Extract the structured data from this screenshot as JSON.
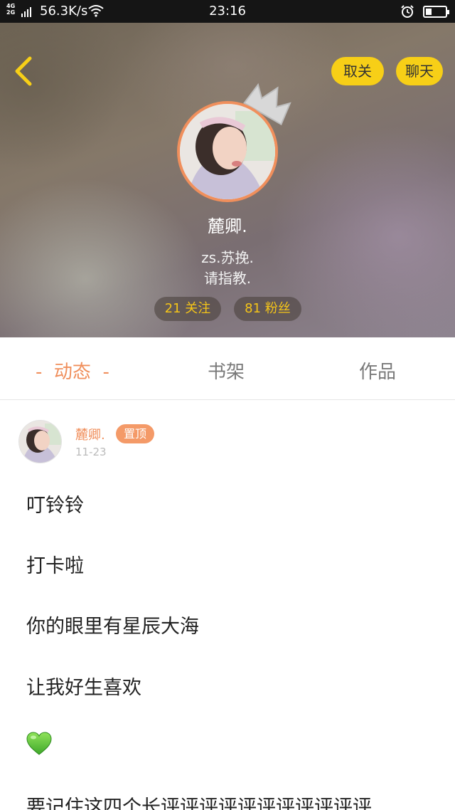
{
  "status_bar": {
    "network_top": "4G",
    "network_bottom": "2G",
    "speed": "56.3K/s",
    "time": "23:16",
    "battery_level": 0.3
  },
  "profile": {
    "nickname": "麓卿.",
    "bio_line1": "zs.苏挽.",
    "bio_line2": "请指教.",
    "following_label": "21 关注",
    "followers_label": "81 粉丝",
    "unfollow_label": "取关",
    "chat_label": "聊天",
    "accent_color": "#f08f5c",
    "button_color": "#f7cf17"
  },
  "tabs": [
    {
      "label": "-  动态  -",
      "active": true
    },
    {
      "label": "书架",
      "active": false
    },
    {
      "label": "作品",
      "active": false
    }
  ],
  "post": {
    "author": "麓卿.",
    "badge": "置顶",
    "date": "11-23",
    "lines": [
      "叮铃铃",
      "打卡啦",
      "你的眼里有星辰大海",
      "让我好生喜欢",
      "要记住这四个长评评评评评评评评评评评"
    ],
    "emoji": "green-heart-icon"
  }
}
